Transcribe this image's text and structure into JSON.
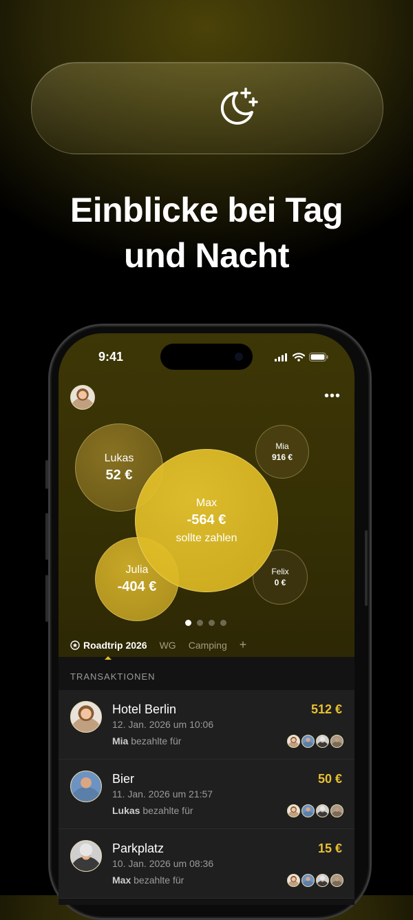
{
  "hero": {
    "icon": "moon-stars-icon",
    "headline_line1": "Einblicke bei Tag",
    "headline_line2": "und Nacht"
  },
  "status_bar": {
    "time": "9:41"
  },
  "bubbles": [
    {
      "name": "Lukas",
      "amount": "52 €"
    },
    {
      "name": "Mia",
      "amount": "916 €"
    },
    {
      "name": "Max",
      "amount": "-564 €",
      "subtitle": "sollte zahlen"
    },
    {
      "name": "Julia",
      "amount": "-404 €"
    },
    {
      "name": "Felix",
      "amount": "0 €"
    }
  ],
  "pager": {
    "pages": 4,
    "active": 1
  },
  "tabs": [
    {
      "label": "Roadtrip 2026",
      "active": true,
      "icon": "star-circle-icon"
    },
    {
      "label": "WG",
      "active": false
    },
    {
      "label": "Camping",
      "active": false
    },
    {
      "label": "+",
      "active": false
    }
  ],
  "transactions": {
    "section_title": "TRANSAKTIONEN",
    "items": [
      {
        "title": "Hotel Berlin",
        "date": "12. Jan. 2026 um 10:06",
        "payer": "Mia",
        "payer_suffix": " bezahlte für",
        "amount": "512 €"
      },
      {
        "title": "Bier",
        "date": "11. Jan. 2026 um 21:57",
        "payer": "Lukas",
        "payer_suffix": " bezahlte für",
        "amount": "50 €"
      },
      {
        "title": "Parkplatz",
        "date": "10. Jan. 2026 um 08:36",
        "payer": "Max",
        "payer_suffix": " bezahlte für",
        "amount": "15 €"
      }
    ]
  },
  "colors": {
    "accent_gold": "#e8c032",
    "background": "#000000",
    "card": "#1f1f1f"
  }
}
